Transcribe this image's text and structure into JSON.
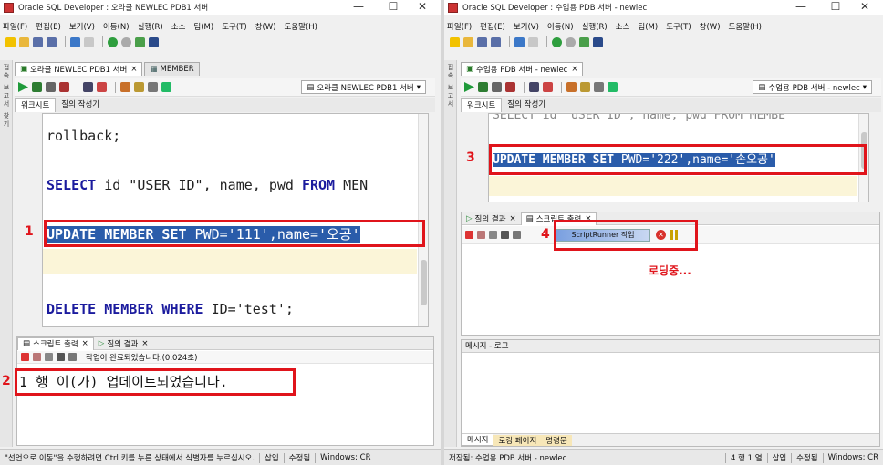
{
  "left": {
    "title": "Oracle SQL Developer : 오라클 NEWLEC PDB1 서버",
    "controls": {
      "min": "—",
      "max": "☐",
      "close": "✕"
    },
    "menu": [
      "파일(F)",
      "편집(E)",
      "보기(V)",
      "이동(N)",
      "실행(R)",
      "소스",
      "팀(M)",
      "도구(T)",
      "창(W)",
      "도움말(H)"
    ],
    "side_strip": [
      "접속",
      "보고서",
      "찾기"
    ],
    "doc_tabs": [
      {
        "label": "오라클 NEWLEC PDB1 서버",
        "close": "×"
      },
      {
        "label": "MEMBER",
        "close": "×"
      }
    ],
    "connection": "오라클 NEWLEC PDB1 서버",
    "sub_tabs": [
      "워크시트",
      "질의 작성기"
    ],
    "code": {
      "rollback": "rollback;",
      "select_kw1": "SELECT",
      "select_rest": " id \"USER ID\", name, pwd ",
      "select_kw2": "FROM",
      "select_tail": " MEN",
      "update_kw": "UPDATE MEMBER SET",
      "update_rest": " PWD='111',name='오공'",
      "delete_kw": "DELETE MEMBER WHERE",
      "delete_rest": " ID='test';"
    },
    "annotations": {
      "n1": "1",
      "n2": "2"
    },
    "output_tabs": [
      {
        "label": "스크립트 출력",
        "close": "×"
      },
      {
        "label": "질의 결과",
        "close": "×"
      }
    ],
    "output_status": "작업이 완료되었습니다.(0.024초)",
    "output_text": "1 행 이(가) 업데이트되었습니다.",
    "statusbar": [
      "\"선언으로 이동\"을 수행하려면 Ctrl 키를 누른 상태에서 식별자를 누르십시오.",
      "삽입",
      "수정됨",
      "Windows: CR"
    ]
  },
  "right": {
    "title": "Oracle SQL Developer : 수업용 PDB 서버 - newlec",
    "controls": {
      "min": "—",
      "max": "☐",
      "close": "✕"
    },
    "menu": [
      "파일(F)",
      "편집(E)",
      "보기(V)",
      "이동(N)",
      "실행(R)",
      "소스",
      "팀(M)",
      "도구(T)",
      "창(W)",
      "도움말(H)"
    ],
    "side_strip": [
      "접속",
      "보고서"
    ],
    "doc_tabs": [
      {
        "label": "수업용 PDB 서버 - newlec",
        "close": "×"
      }
    ],
    "connection": "수업용 PDB 서버 - newlec",
    "sub_tabs": [
      "워크시트",
      "질의 작성기"
    ],
    "code": {
      "select_line": "SELECT id \"USER ID\", name, pwd FROM MEMBE",
      "update_kw": "UPDATE MEMBER SET",
      "update_rest": " PWD='222',name='손오공'",
      "update_tail": " "
    },
    "annotations": {
      "n3": "3",
      "n4": "4",
      "loading": "로딩중..."
    },
    "result_tabs": [
      {
        "label": "질의 결과",
        "close": "×"
      },
      {
        "label": "스크립트 출력",
        "close": "×"
      }
    ],
    "task": "ScriptRunner 작업",
    "messages_title": "메시지 - 로그",
    "bottom_tabs": [
      "메시지",
      "로깅 페이지",
      "명령문"
    ],
    "statusbar": [
      "저장됨: 수업용 PDB 서버 - newlec",
      "4 행 1 열",
      "삽입",
      "수정됨",
      "Windows: CR"
    ]
  },
  "colors": {
    "highlight": "#2a5caa",
    "annotation": "#e0141b",
    "keyword": "#1b1b9e"
  }
}
